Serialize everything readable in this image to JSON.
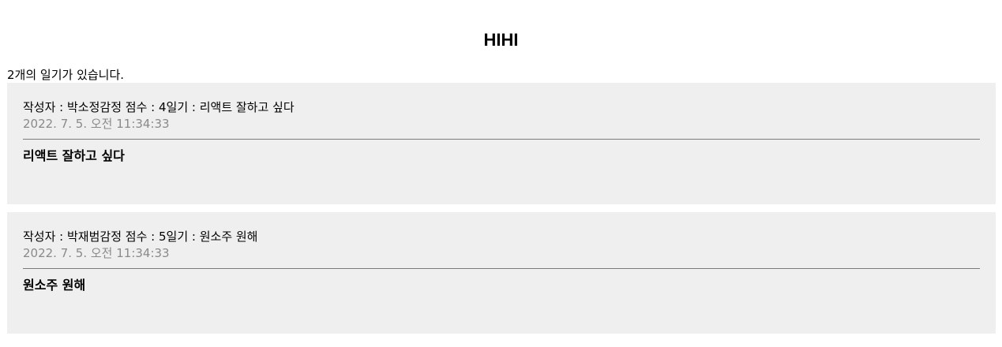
{
  "header": {
    "title": "HIHI"
  },
  "summary": {
    "count_text": "2개의 일기가 있습니다."
  },
  "diaries": [
    {
      "author_label": "작성자 : ",
      "author": "박소정",
      "emotion_label": "감정 점수 : ",
      "emotion": "4",
      "diary_label": "일기 : ",
      "diary": "리액트 잘하고 싶다",
      "date": "2022. 7. 5. 오전 11:34:33",
      "content": "리액트 잘하고 싶다"
    },
    {
      "author_label": "작성자 : ",
      "author": "박재범",
      "emotion_label": "감정 점수 : ",
      "emotion": "5",
      "diary_label": "일기 : ",
      "diary": "원소주 원해",
      "date": "2022. 7. 5. 오전 11:34:33",
      "content": "원소주 원해"
    }
  ]
}
